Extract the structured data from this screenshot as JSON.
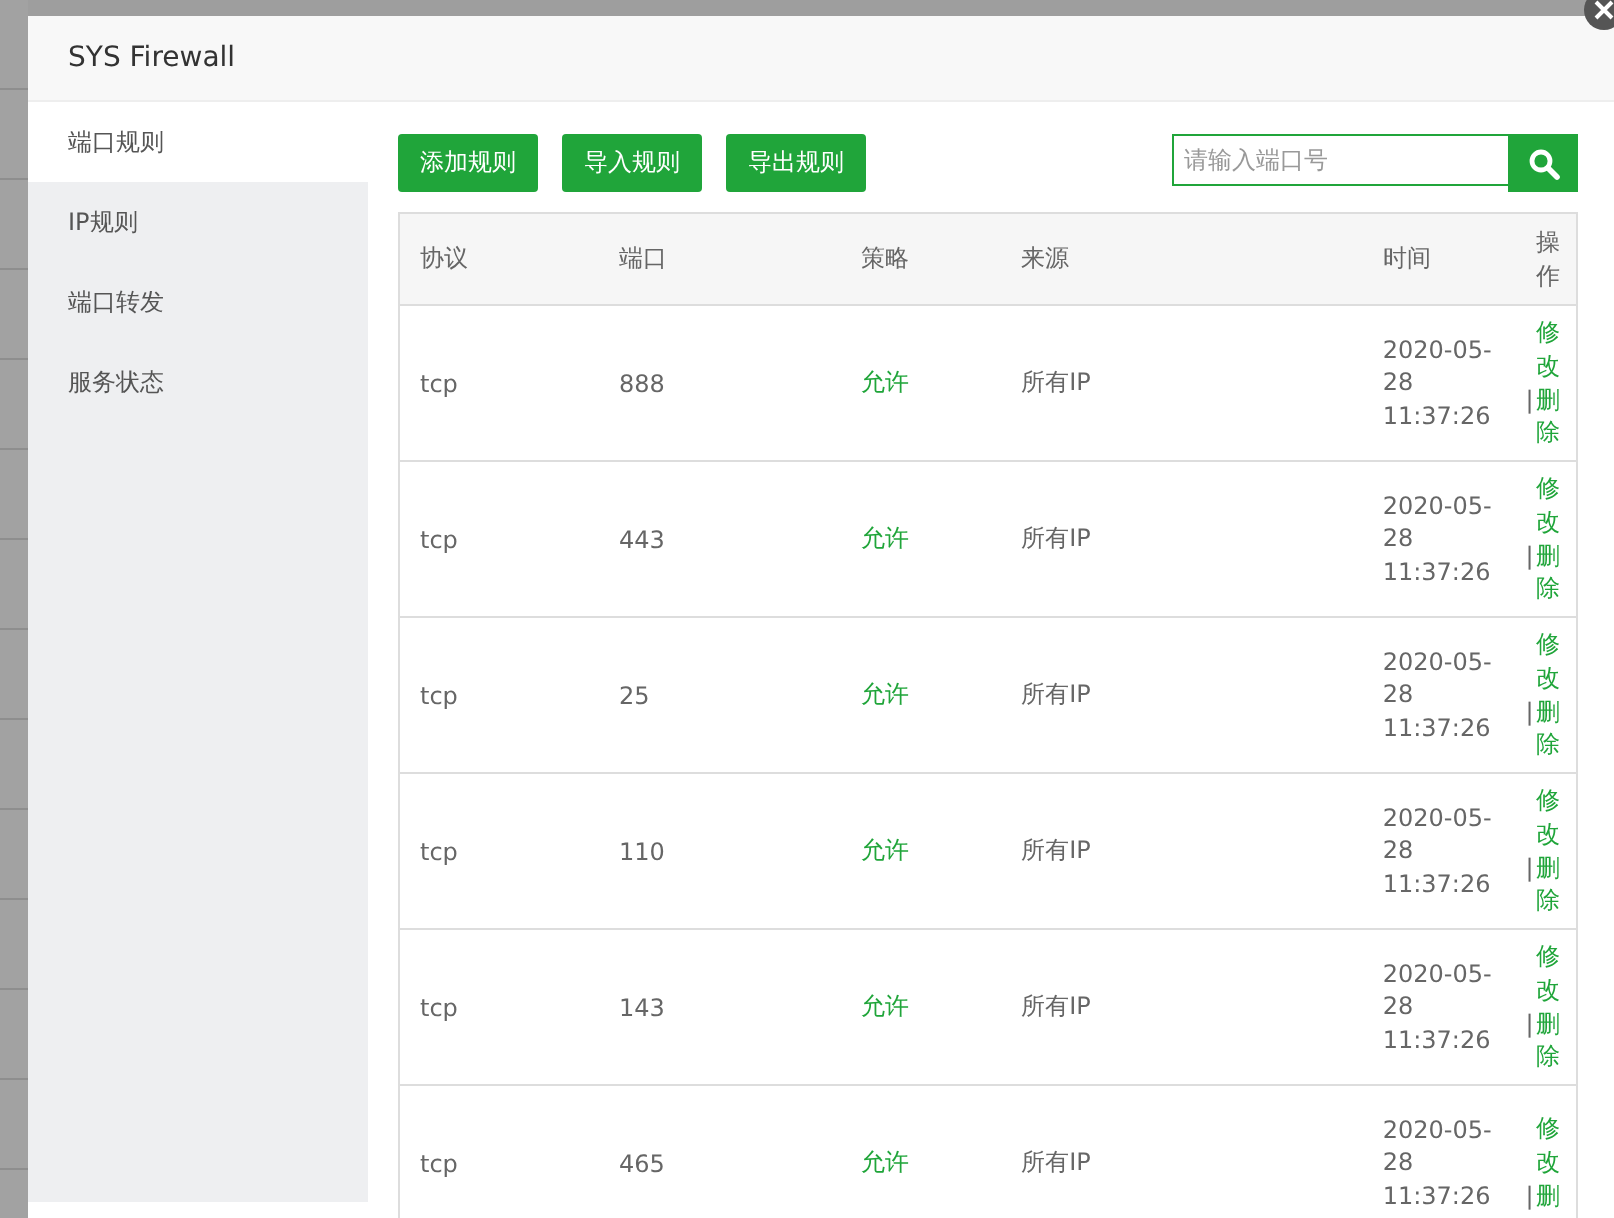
{
  "window": {
    "title": "SYS Firewall"
  },
  "sidebar": {
    "items": [
      {
        "label": "端口规则",
        "selected": true
      },
      {
        "label": "IP规则",
        "selected": false
      },
      {
        "label": "端口转发",
        "selected": false
      },
      {
        "label": "服务状态",
        "selected": false
      }
    ]
  },
  "toolbar": {
    "buttons": [
      "添加规则",
      "导入规则",
      "导出规则"
    ],
    "search": {
      "placeholder": "请输入端口号"
    }
  },
  "table": {
    "columns": [
      "协议",
      "端口",
      "策略",
      "来源",
      "时间",
      "操作"
    ],
    "rows": [
      {
        "protocol": "tcp",
        "port": "888",
        "policy": "允许",
        "source": "所有IP",
        "time": "2020-05-28 11:37:26",
        "actions": [
          "修改",
          "|",
          "删除"
        ]
      },
      {
        "protocol": "tcp",
        "port": "443",
        "policy": "允许",
        "source": "所有IP",
        "time": "2020-05-28 11:37:26",
        "actions": [
          "修改",
          "|",
          "删除"
        ]
      },
      {
        "protocol": "tcp",
        "port": "25",
        "policy": "允许",
        "source": "所有IP",
        "time": "2020-05-28 11:37:26",
        "actions": [
          "修改",
          "|",
          "删除"
        ]
      },
      {
        "protocol": "tcp",
        "port": "110",
        "policy": "允许",
        "source": "所有IP",
        "time": "2020-05-28 11:37:26",
        "actions": [
          "修改",
          "|",
          "删除"
        ]
      },
      {
        "protocol": "tcp",
        "port": "143",
        "policy": "允许",
        "source": "所有IP",
        "time": "2020-05-28 11:37:26",
        "actions": [
          "修改",
          "|",
          "删除"
        ]
      },
      {
        "protocol": "tcp",
        "port": "465",
        "policy": "允许",
        "source": "所有IP",
        "time": "2020-05-28 11:37:26",
        "actions": [
          "修改",
          "|",
          "删"
        ]
      }
    ]
  }
}
